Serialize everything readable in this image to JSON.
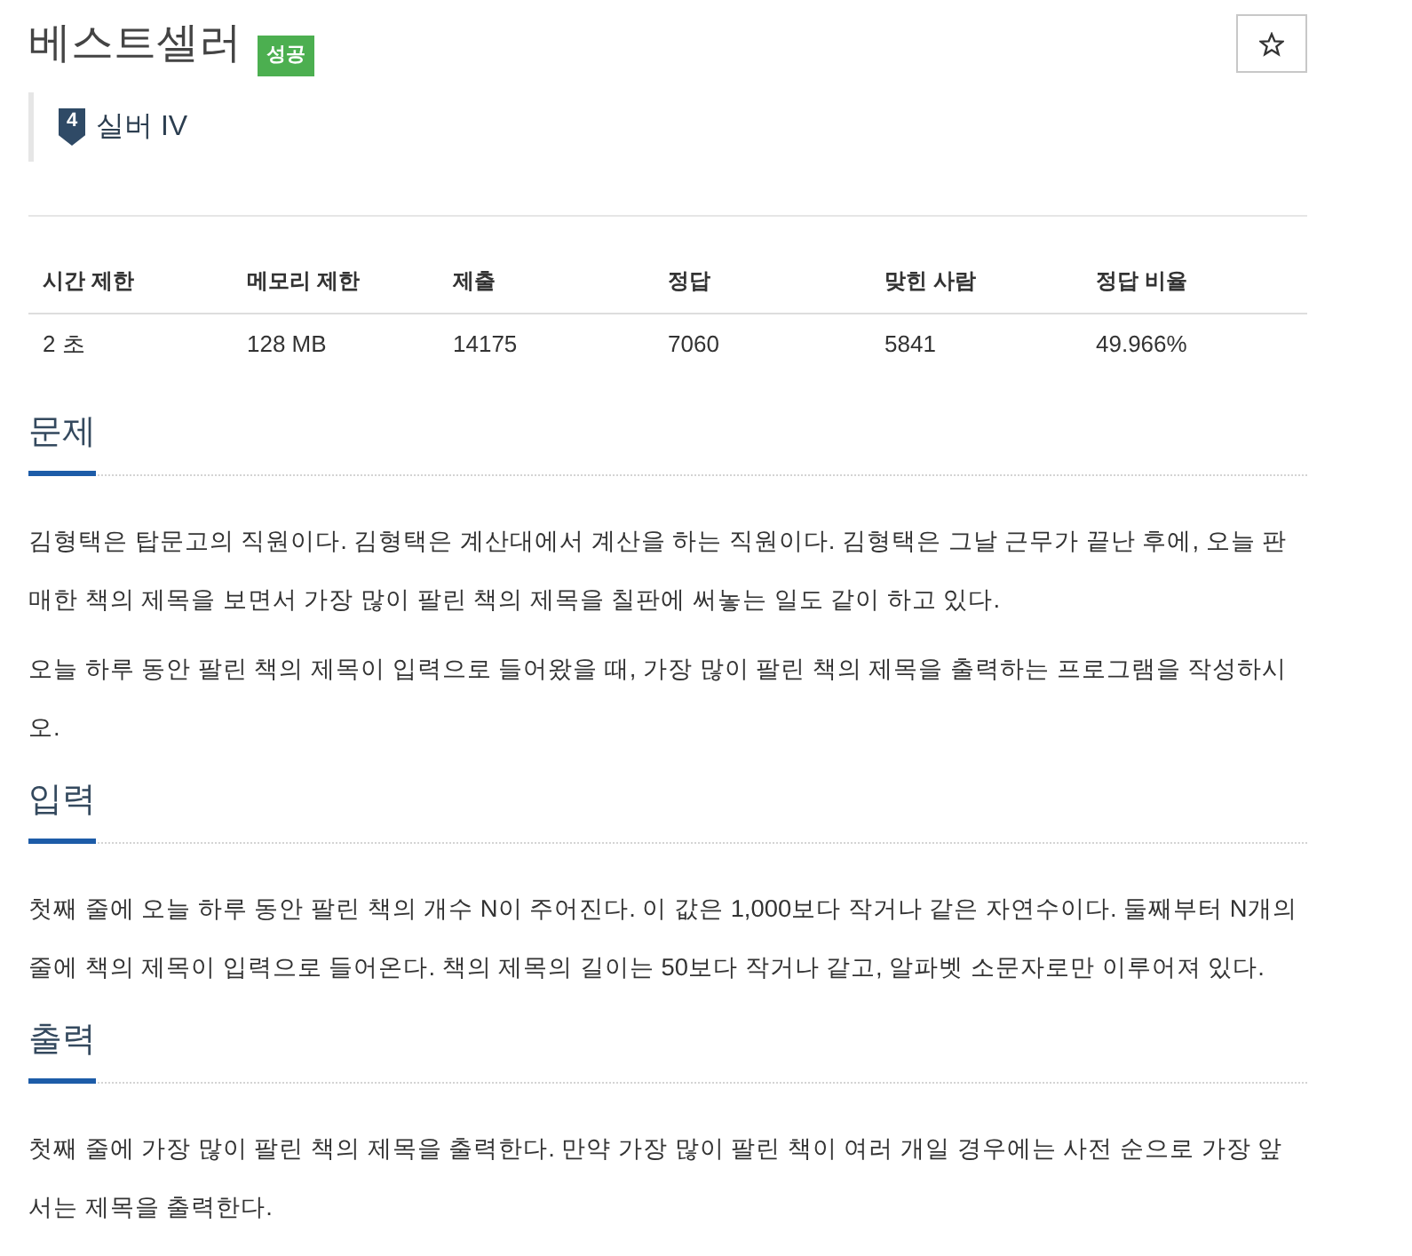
{
  "title": "베스트셀러",
  "result_badge": {
    "label": "성공",
    "kind": "success"
  },
  "star_button": {
    "starred": false
  },
  "tier": {
    "level": "4",
    "name": "실버 IV"
  },
  "stats": {
    "columns": [
      "시간 제한",
      "메모리 제한",
      "제출",
      "정답",
      "맞힌 사람",
      "정답 비율"
    ],
    "rows": [
      [
        "2 초",
        "128 MB",
        "14175",
        "7060",
        "5841",
        "49.966%"
      ]
    ]
  },
  "sections": [
    {
      "heading": "문제",
      "paragraphs": [
        "김형택은 탑문고의 직원이다. 김형택은 계산대에서 계산을 하는 직원이다. 김형택은 그날 근무가 끝난 후에, 오늘 판매한 책의 제목을 보면서 가장 많이 팔린 책의 제목을 칠판에 써놓는 일도 같이 하고 있다.",
        "오늘 하루 동안 팔린 책의 제목이 입력으로 들어왔을 때, 가장 많이 팔린 책의 제목을 출력하는 프로그램을 작성하시오."
      ]
    },
    {
      "heading": "입력",
      "paragraphs": [
        "첫째 줄에 오늘 하루 동안 팔린 책의 개수 N이 주어진다. 이 값은 1,000보다 작거나 같은 자연수이다. 둘째부터 N개의 줄에 책의 제목이 입력으로 들어온다. 책의 제목의 길이는 50보다 작거나 같고, 알파벳 소문자로만 이루어져 있다."
      ]
    },
    {
      "heading": "출력",
      "paragraphs": [
        "첫째 줄에 가장 많이 팔린 책의 제목을 출력한다. 만약 가장 많이 팔린 책이 여러 개일 경우에는 사전 순으로 가장 앞서는 제목을 출력한다."
      ]
    }
  ]
}
